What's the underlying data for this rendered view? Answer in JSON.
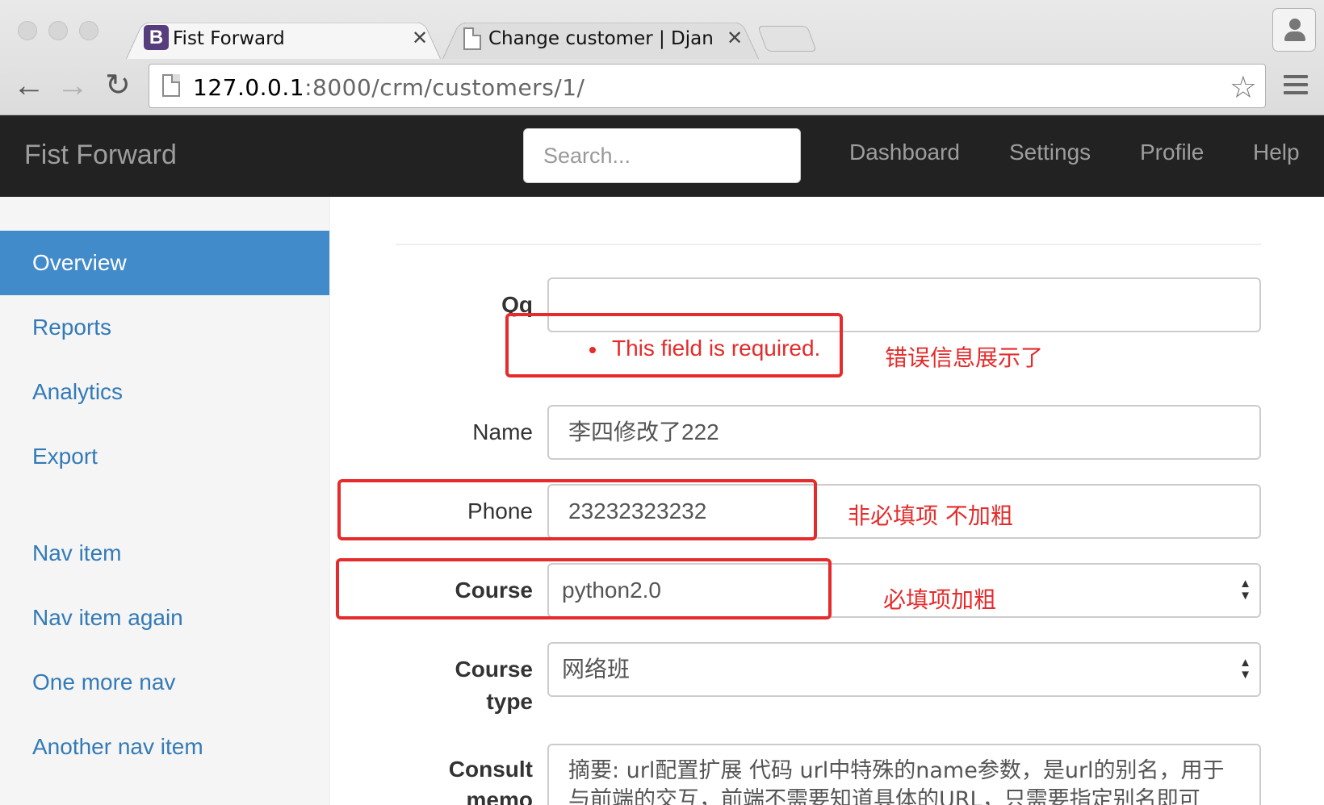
{
  "browser": {
    "tabs": [
      {
        "title": "Fist Forward",
        "active": true
      },
      {
        "title": "Change customer | Django",
        "active": false
      }
    ],
    "url_host": "127.0.0.1",
    "url_path": ":8000/crm/customers/1/"
  },
  "navbar": {
    "brand": "Fist Forward",
    "search_placeholder": "Search...",
    "links": [
      "Dashboard",
      "Settings",
      "Profile",
      "Help"
    ]
  },
  "sidebar": {
    "items": [
      "Overview",
      "Reports",
      "Analytics",
      "Export",
      "Nav item",
      "Nav item again",
      "One more nav",
      "Another nav item"
    ],
    "active_index": 0
  },
  "form": {
    "qq": {
      "label": "Qq",
      "value": "",
      "error": "This field is required.",
      "note": "错误信息展示了"
    },
    "name": {
      "label": "Name",
      "value": "李四修改了222"
    },
    "phone": {
      "label": "Phone",
      "value": "23232323232",
      "note": "非必填项 不加粗"
    },
    "course": {
      "label": "Course",
      "value": "python2.0",
      "note": "必填项加粗"
    },
    "course_type": {
      "label_line1": "Course",
      "label_line2": "type",
      "value": "网络班"
    },
    "consult_memo": {
      "label_line1": "Consult",
      "label_line2": "memo",
      "line1": "摘要: url配置扩展 代码 url中特殊的name参数，是url的别名，用于",
      "line2": "与前端的交互，前端不需要知道具体的URL，只需要指定别名即可"
    }
  },
  "colors": {
    "annotation_red": "#e52b2b",
    "sidebar_active": "#428bca",
    "link": "#337ab7",
    "navbar_bg": "#222222"
  }
}
